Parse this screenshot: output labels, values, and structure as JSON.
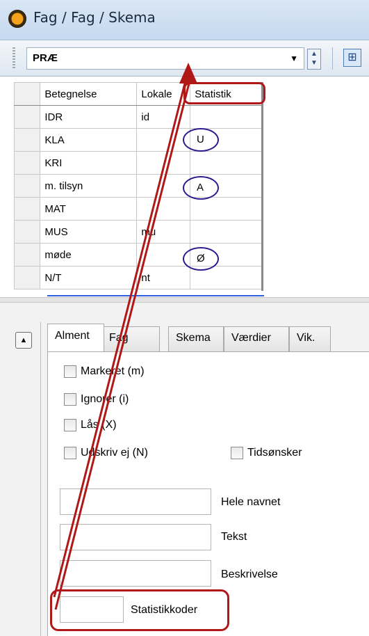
{
  "window": {
    "title": "Fag / Fag / Skema"
  },
  "toolbar": {
    "selector_value": "PRÆ",
    "dropdown_arrow": "▼",
    "spinner_up": "▲",
    "spinner_down": "▼",
    "grid_icon": "⊞"
  },
  "grid": {
    "headers": {
      "betegnelse": "Betegnelse",
      "lokale": "Lokale",
      "statistik": "Statistik"
    },
    "rows": [
      {
        "betegnelse": "IDR",
        "lokale": "id",
        "statistik": ""
      },
      {
        "betegnelse": "KLA",
        "lokale": "",
        "statistik": "U"
      },
      {
        "betegnelse": "KRI",
        "lokale": "",
        "statistik": ""
      },
      {
        "betegnelse": "m. tilsyn",
        "lokale": "",
        "statistik": "A"
      },
      {
        "betegnelse": "MAT",
        "lokale": "",
        "statistik": ""
      },
      {
        "betegnelse": "MUS",
        "lokale": "mu",
        "statistik": ""
      },
      {
        "betegnelse": "møde",
        "lokale": "",
        "statistik": "Ø"
      },
      {
        "betegnelse": "N/T",
        "lokale": "nt",
        "statistik": ""
      }
    ]
  },
  "detail": {
    "collapse_glyph": "▲",
    "tabs": [
      {
        "label": "Alment",
        "active": true
      },
      {
        "label": "Fag",
        "active": false
      },
      {
        "label": "Skema",
        "active": false
      },
      {
        "label": "Værdier",
        "active": false
      },
      {
        "label": "Vik.",
        "active": false
      }
    ],
    "checkboxes": {
      "markeret": "Markeret (m)",
      "ignorer": "Ignorer (i)",
      "laas": "Lås (X)",
      "udskriv": "Udskriv ej (N)",
      "tidsonsker": "Tidsønsker"
    },
    "fields": {
      "hele_navnet": {
        "label": "Hele navnet",
        "value": ""
      },
      "tekst": {
        "label": "Tekst",
        "value": ""
      },
      "beskrivelse": {
        "label": "Beskrivelse",
        "value": ""
      },
      "statistikkoder": {
        "label": "Statistikkoder",
        "value": ""
      }
    }
  },
  "colors": {
    "annotation_red": "#b01818",
    "circle_navy": "#2c1a8f",
    "grid_blue_line": "#2e5fe0"
  }
}
